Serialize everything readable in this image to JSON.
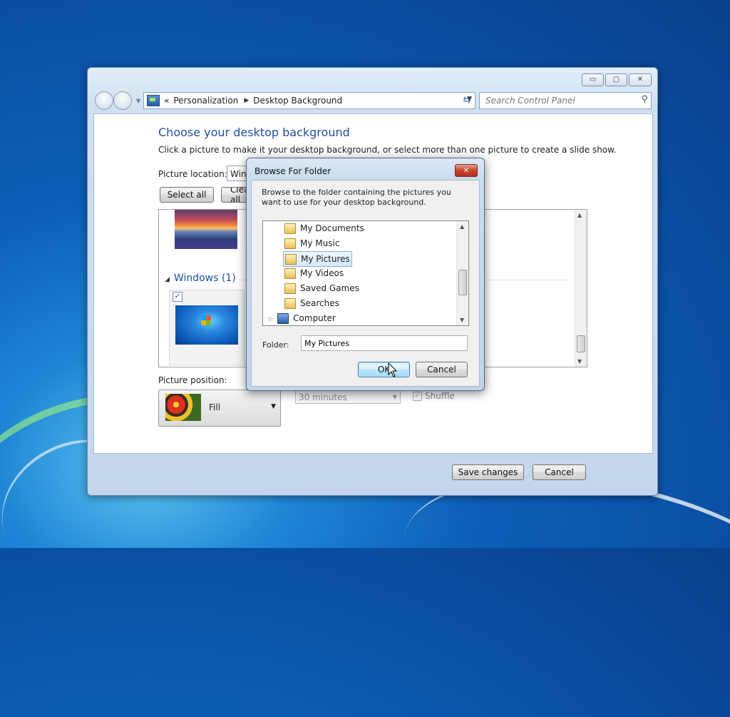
{
  "window": {
    "caption_buttons": {
      "minimize": "▭",
      "maximize": "▢",
      "close": "✕"
    },
    "breadcrumb": {
      "prefix": "«",
      "items": [
        "Personalization",
        "Desktop Background"
      ]
    },
    "search": {
      "placeholder": "Search Control Panel"
    }
  },
  "main": {
    "heading": "Choose your desktop background",
    "description": "Click a picture to make it your desktop background, or select more than one picture to create a slide show.",
    "picture_location_label": "Picture location:",
    "picture_location_value": "Windows Desktop Backgrounds",
    "select_all_label": "Select all",
    "clear_all_label": "Clear all",
    "group_title": "Windows (1)",
    "picture_position_label": "Picture position:",
    "picture_position_value": "Fill",
    "interval_value": "30 minutes",
    "shuffle_label": "Shuffle",
    "save_label": "Save changes",
    "cancel_label": "Cancel"
  },
  "dialog": {
    "title": "Browse For Folder",
    "close_glyph": "✕",
    "description": "Browse to the folder containing the pictures you want to use for your desktop background.",
    "tree_items": [
      {
        "label": "My Documents"
      },
      {
        "label": "My Music"
      },
      {
        "label": "My Pictures",
        "selected": true
      },
      {
        "label": "My Videos"
      },
      {
        "label": "Saved Games"
      },
      {
        "label": "Searches"
      },
      {
        "label": "Computer"
      }
    ],
    "folder_label": "Folder:",
    "folder_value": "My Pictures",
    "ok_label": "OK",
    "cancel_label": "Cancel"
  }
}
